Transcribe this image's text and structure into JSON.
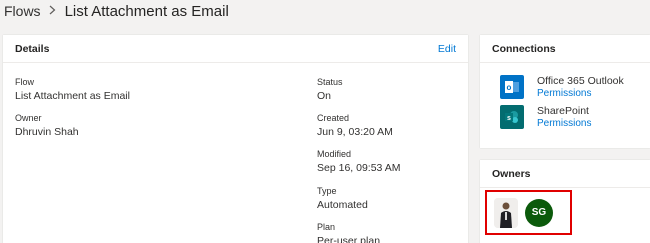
{
  "breadcrumb": {
    "root": "Flows",
    "separator": ">",
    "current": "List Attachment as Email"
  },
  "details": {
    "title": "Details",
    "edit_label": "Edit",
    "left_fields": [
      {
        "label": "Flow",
        "value": "List Attachment as Email"
      },
      {
        "label": "Owner",
        "value": "Dhruvin Shah"
      }
    ],
    "right_fields": [
      {
        "label": "Status",
        "value": "On"
      },
      {
        "label": "Created",
        "value": "Jun 9, 03:20 AM"
      },
      {
        "label": "Modified",
        "value": "Sep 16, 09:53 AM"
      },
      {
        "label": "Type",
        "value": "Automated"
      },
      {
        "label": "Plan",
        "value": "Per-user plan"
      }
    ]
  },
  "connections": {
    "title": "Connections",
    "items": [
      {
        "name": "Office 365 Outlook",
        "link": "Permissions",
        "icon": "outlook-icon",
        "color": "#0072c6"
      },
      {
        "name": "SharePoint",
        "link": "Permissions",
        "icon": "sharepoint-icon",
        "color": "#036c70"
      }
    ]
  },
  "owners": {
    "title": "Owners",
    "avatars": [
      {
        "type": "photo",
        "icon": "person-photo"
      },
      {
        "type": "initials",
        "initials": "SG",
        "color": "#0b5a0b"
      }
    ],
    "highlight_color": "#e00000"
  }
}
